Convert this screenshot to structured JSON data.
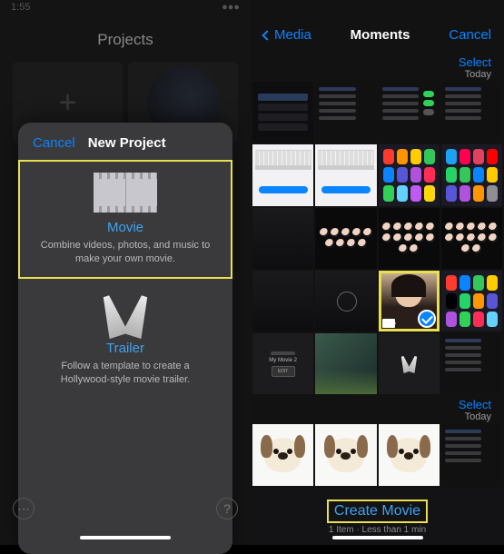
{
  "left": {
    "status_time": "1:55",
    "header": "Projects",
    "sheet": {
      "cancel": "Cancel",
      "title": "New Project",
      "movie": {
        "title": "Movie",
        "desc": "Combine videos, photos, and music to make your own movie."
      },
      "trailer": {
        "title": "Trailer",
        "desc": "Follow a template to create a Hollywood-style movie trailer."
      }
    },
    "more_glyph": "⋯",
    "help_glyph": "?"
  },
  "right": {
    "nav": {
      "back": "Media",
      "title": "Moments",
      "cancel": "Cancel"
    },
    "section": {
      "select": "Select",
      "today": "Today"
    },
    "my_movie_label": "My Movie 2",
    "edit_label": "EDIT",
    "footer": {
      "create": "Create Movie",
      "sub": "1 Item · Less than 1 min"
    }
  },
  "app_colors": [
    "#ff3b30",
    "#ff9500",
    "#ffcc00",
    "#34c759",
    "#0a84ff",
    "#5856d6",
    "#af52de",
    "#ff2d55",
    "#30d158",
    "#64d2ff",
    "#bf5af2",
    "#ffd60a"
  ]
}
